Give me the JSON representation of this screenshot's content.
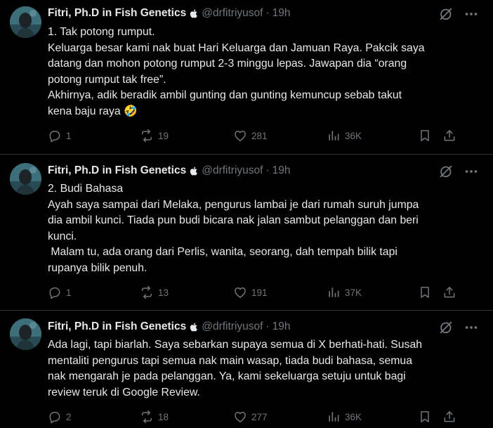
{
  "tweets": [
    {
      "author": {
        "display_name": "Fitri, Ph.D in Fish Genetics",
        "handle": "@drfitriyusof",
        "time": "19h"
      },
      "body": "1. Tak potong rumput.\nKeluarga besar kami nak buat Hari Keluarga dan Jamuan Raya. Pakcik saya\ndatang dan mohon potong rumput 2-3 minggu lepas. Jawapan dia “orang\npotong rumput tak free”.\nAkhirnya, adik beradik ambil gunting dan gunting kemuncup sebab takut\nkena baju raya 🤣",
      "stats": {
        "replies": "1",
        "reposts": "19",
        "likes": "281",
        "views": "36K"
      }
    },
    {
      "author": {
        "display_name": "Fitri, Ph.D in Fish Genetics",
        "handle": "@drfitriyusof",
        "time": "19h"
      },
      "body": "2. Budi Bahasa\nAyah saya sampai dari Melaka, pengurus lambai je dari rumah suruh jumpa\ndia ambil kunci. Tiada pun budi bicara nak jalan sambut pelanggan dan beri\nkunci.\n Malam tu, ada orang dari Perlis, wanita, seorang, dah tempah bilik tapi\nrupanya bilik penuh.",
      "stats": {
        "replies": "1",
        "reposts": "13",
        "likes": "191",
        "views": "37K"
      }
    },
    {
      "author": {
        "display_name": "Fitri, Ph.D in Fish Genetics",
        "handle": "@drfitriyusof",
        "time": "19h"
      },
      "body": "Ada lagi, tapi biarlah. Saya sebarkan supaya semua di X berhati-hati. Susah\nmentaliti pengurus tapi semua nak main wasap, tiada budi bahasa, semua\nnak mengarah je pada pelanggan. Ya, kami sekeluarga setuju untuk bagi\nreview teruk di Google Review.",
      "stats": {
        "replies": "2",
        "reposts": "18",
        "likes": "277",
        "views": "36K"
      }
    }
  ],
  "colors": {
    "background": "#000000",
    "text": "#e7e9ea",
    "muted": "#71767b",
    "divider": "#2f3336"
  },
  "icons": [
    "apple-icon",
    "grok-icon",
    "more-icon",
    "reply-icon",
    "repost-icon",
    "like-icon",
    "views-icon",
    "bookmark-icon",
    "share-icon"
  ]
}
